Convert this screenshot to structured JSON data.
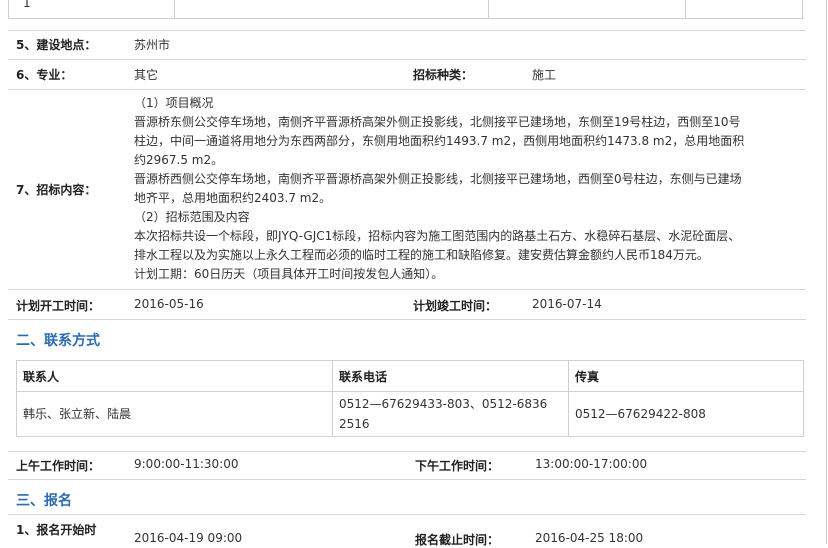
{
  "top_table": {
    "cell_value": "1"
  },
  "location": {
    "label": "5、建设地点：",
    "value": "苏州市"
  },
  "specialty": {
    "label": "6、专业：",
    "value": "其它",
    "type_label": "招标种类：",
    "type_value": "施工"
  },
  "content": {
    "label": "7、招标内容：",
    "lines": [
      "（1）项目概况",
      "晋源桥东侧公交停车场地，南侧齐平晋源桥高架外侧正投影线，北侧接平已建场地，东侧至19号柱边，西侧至10号",
      "柱边，中间一通道将用地分为东西两部分，东侧用地面积约1493.7 m2，西侧用地面积约1473.8 m2，总用地面积",
      "约2967.5 m2。",
      "晋源桥西侧公交停车场地，南侧齐平晋源桥高架外侧正投影线，北侧接平已建场地，西侧至0号柱边，东侧与已建场",
      "地齐平，总用地面积约2403.7 m2。",
      "（2）招标范围及内容",
      "本次招标共设一个标段，即JYQ-GJC1标段，招标内容为施工图范围内的路基土石方、水稳碎石基层、水泥砼面层、",
      "排水工程以及为实施以上永久工程而必须的临时工程的施工和缺陷修复。建安费估算金额约人民币184万元。",
      "计划工期：60日历天（项目具体开工时间按发包人通知）。"
    ]
  },
  "schedule": {
    "start_label": "计划开工时间：",
    "start_value": "2016-05-16",
    "end_label": "计划竣工时间：",
    "end_value": "2016-07-14"
  },
  "contact_section": {
    "title": "二、联系方式",
    "headers": [
      "联系人",
      "联系电话",
      "传真"
    ],
    "row": {
      "person": "韩乐、张立新、陆晨",
      "phone_line1": "0512—67629433-803、0512-6836",
      "phone_line2": "2516",
      "fax": "0512—67629422-808"
    }
  },
  "work_hours": {
    "am_label": "上午工作时间：",
    "am_value": "9:00:00-11:30:00",
    "pm_label": "下午工作时间：",
    "pm_value": "13:00:00-17:00:00"
  },
  "signup_section": {
    "title": "三、报名",
    "start_label": "1、报名开始时",
    "start_value": "2016-04-19 09:00",
    "end_label": "报名截止时间：",
    "end_value": "2016-04-25 18:00"
  }
}
